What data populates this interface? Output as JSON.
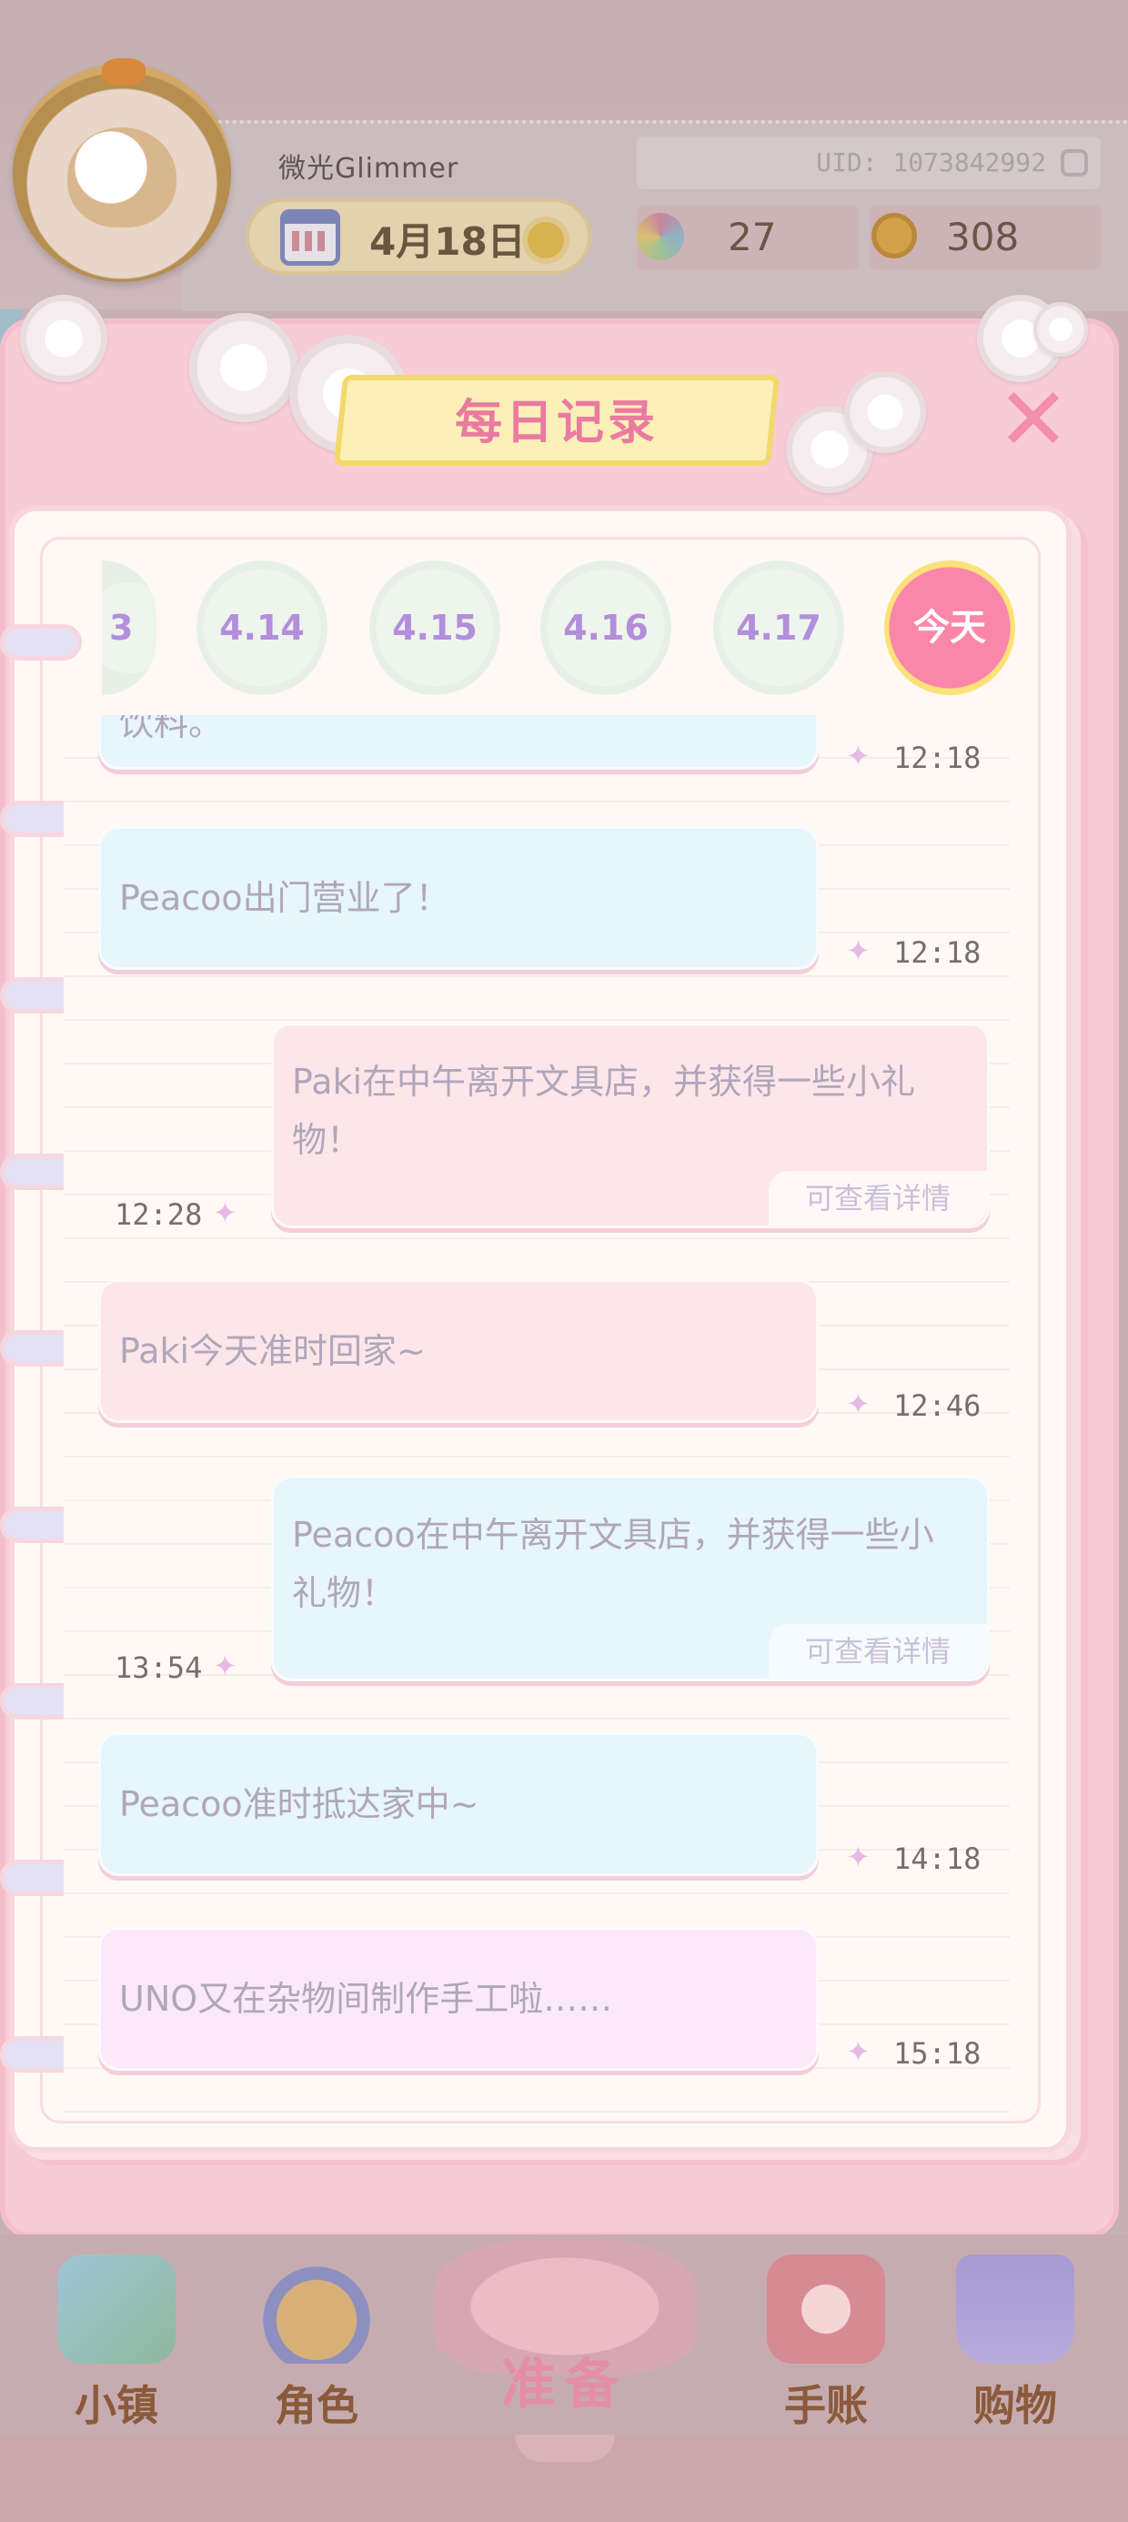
{
  "player": {
    "name": "微光Glimmer",
    "uid": "UID: 1073842992"
  },
  "date_pill": {
    "date": "4月18日",
    "weather_icon": "sun-icon"
  },
  "stats": {
    "gems": "27",
    "coins": "308"
  },
  "panel": {
    "title": "每日记录",
    "close_label": "✕"
  },
  "date_tabs": [
    {
      "label": "3"
    },
    {
      "label": "4.14"
    },
    {
      "label": "4.15"
    },
    {
      "label": "4.16"
    },
    {
      "label": "4.17"
    },
    {
      "label": "今天"
    }
  ],
  "entries": [
    {
      "text": "饮料。",
      "time": "12:18",
      "side": "left",
      "color": "blue"
    },
    {
      "text": "Peacoo出门营业了！",
      "time": "12:18",
      "side": "left",
      "color": "blue"
    },
    {
      "text_line1": "Paki在中午离开文具店，并获得一些小礼",
      "text_line2": "物！",
      "time": "12:28",
      "side": "right",
      "color": "pink",
      "detail": "可查看详情"
    },
    {
      "text": "Paki今天准时回家~",
      "time": "12:46",
      "side": "left",
      "color": "pink"
    },
    {
      "text_line1": "Peacoo在中午离开文具店，并获得一些小",
      "text_line2": "礼物！",
      "time": "13:54",
      "side": "right",
      "color": "blue",
      "detail": "可查看详情"
    },
    {
      "text": "Peacoo准时抵达家中~",
      "time": "14:18",
      "side": "left",
      "color": "blue"
    },
    {
      "text": "UNO又在杂物间制作手工啦……",
      "time": "15:18",
      "side": "left",
      "color": "purple"
    }
  ],
  "bottom_nav": {
    "town": "小镇",
    "character": "角色",
    "prepare": "准备",
    "journal": "手账",
    "shop": "购物"
  },
  "colors": {
    "accent_pink": "#f38eab",
    "active_tab": "#fa86aa",
    "tab_text": "#b38edb"
  }
}
